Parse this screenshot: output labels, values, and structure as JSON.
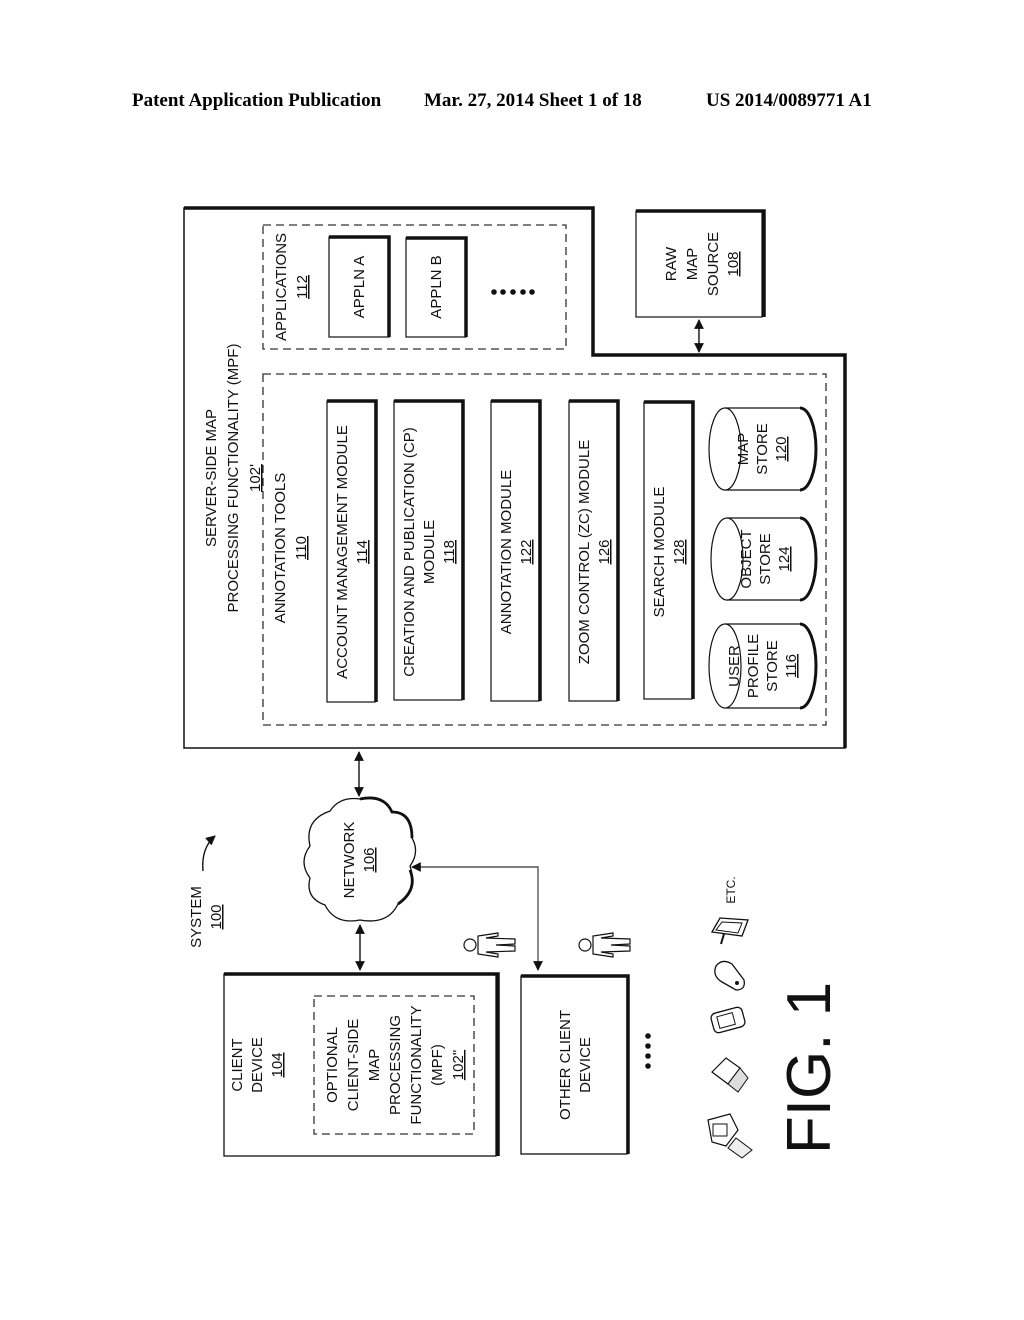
{
  "header": {
    "publication": "Patent Application Publication",
    "date_sheet": "Mar. 27, 2014  Sheet 1 of 18",
    "patent_number": "US 2014/0089771 A1"
  },
  "figure": {
    "label": "FIG. 1",
    "orientation": "rotated 90° counterclockwise",
    "system": {
      "title": "SYSTEM",
      "ref": "100"
    },
    "server": {
      "title_line1": "SERVER-SIDE MAP",
      "title_line2": "PROCESSING FUNCTIONALITY (MPF)",
      "ref": "102'"
    },
    "applications": {
      "title": "APPLICATIONS",
      "ref": "112",
      "items": [
        "APPLN A",
        "APPLN B"
      ],
      "ellipsis": "• • • •"
    },
    "raw_map_source": {
      "lines": [
        "RAW",
        "MAP",
        "SOURCE"
      ],
      "ref": "108"
    },
    "annotation_tools": {
      "title": "ANNOTATION TOOLS",
      "ref": "110",
      "modules": [
        {
          "line1": "ACCOUNT MANAGEMENT MODULE",
          "line2": "",
          "ref": "114"
        },
        {
          "line1": "CREATION AND PUBLICATION (CP)",
          "line2": "MODULE",
          "ref": "118"
        },
        {
          "line1": "ANNOTATION MODULE",
          "line2": "",
          "ref": "122"
        },
        {
          "line1": "ZOOM CONTROL (ZC) MODULE",
          "line2": "",
          "ref": "126"
        },
        {
          "line1": "SEARCH MODULE",
          "line2": "",
          "ref": "128"
        }
      ],
      "stores": [
        {
          "lines": [
            "USER",
            "PROFILE",
            "STORE"
          ],
          "ref": "116"
        },
        {
          "lines": [
            "OBJECT",
            "STORE"
          ],
          "ref": "124"
        },
        {
          "lines": [
            "MAP",
            "STORE"
          ],
          "ref": "120"
        }
      ]
    },
    "network": {
      "title": "NETWORK",
      "ref": "106"
    },
    "client_device": {
      "lines": [
        "CLIENT",
        "DEVICE"
      ],
      "ref": "104",
      "optional_mpf": {
        "lines": [
          "OPTIONAL",
          "CLIENT-SIDE",
          "MAP",
          "PROCESSING",
          "FUNCTIONALITY",
          "(MPF)"
        ],
        "ref": "102\""
      }
    },
    "other_client_device": {
      "lines": [
        "OTHER CLIENT",
        "DEVICE"
      ]
    },
    "devices": {
      "ellipsis": "• • • •",
      "items": [
        "desktop-computer",
        "laptop",
        "handheld-pda",
        "mobile-phone",
        "tablet-with-stylus"
      ],
      "etc_label": "ETC."
    },
    "users": [
      "user-figure",
      "user-figure"
    ]
  }
}
